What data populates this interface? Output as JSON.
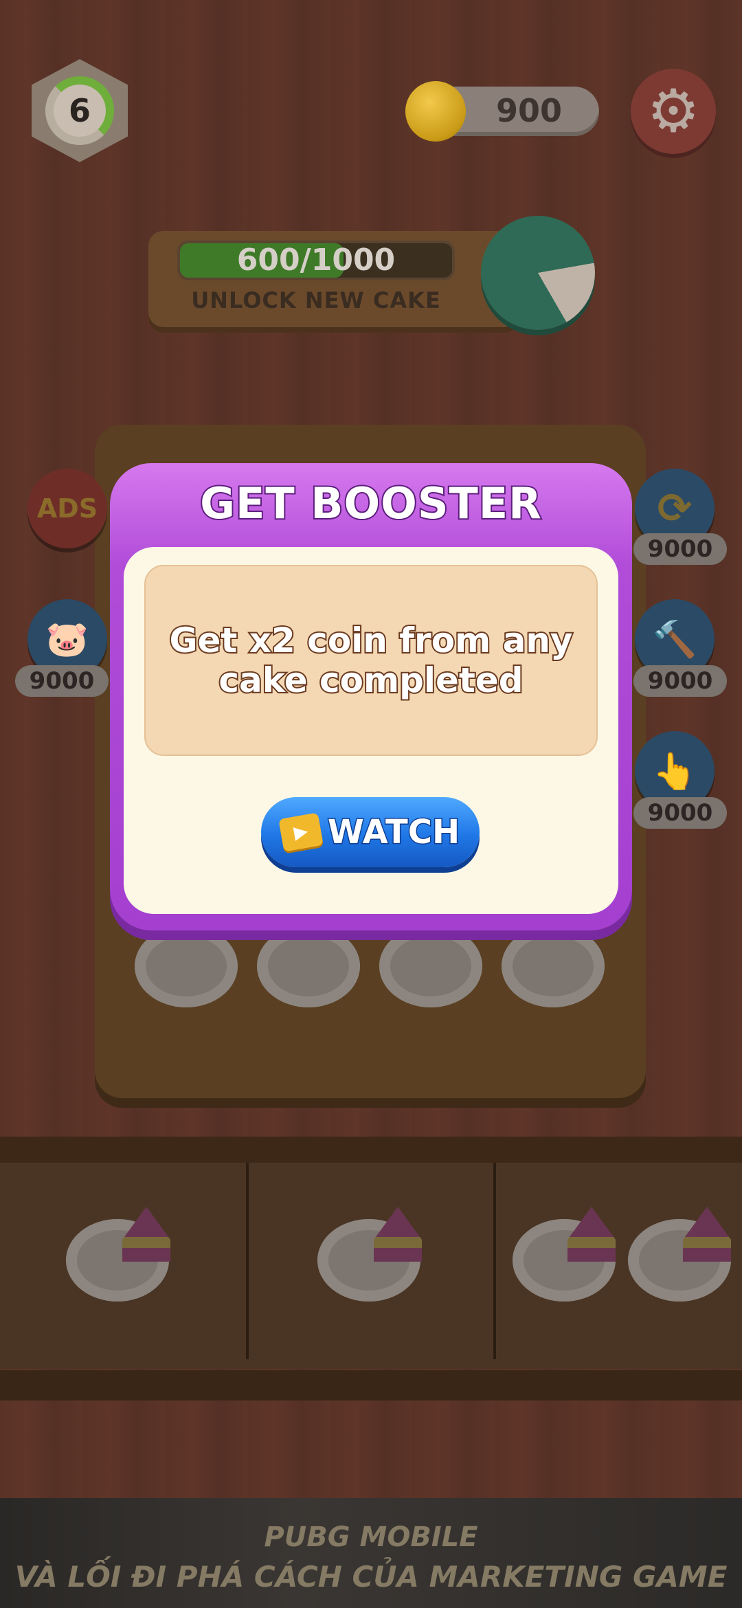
{
  "hud": {
    "level": "6",
    "level_progress": 0.6,
    "coins": "900",
    "settings_icon": "gear-icon"
  },
  "progress": {
    "text": "600/1000",
    "value": 600,
    "max": 1000,
    "label": "UNLOCK NEW CAKE"
  },
  "boosters": {
    "ads_label": "ADS",
    "left_price": "9000",
    "right_prices": [
      "9000",
      "9000",
      "9000"
    ]
  },
  "modal": {
    "title": "GET BOOSTER",
    "description": "Get x2 coin from any cake completed",
    "watch_label": "WATCH",
    "colors": {
      "header": "#b04cd8",
      "body": "#fdf8e6",
      "button": "#1f77e6"
    }
  },
  "ad_banner": {
    "line1": "PUBG MOBILE",
    "line2": "VÀ LỐI ĐI PHÁ CÁCH CỦA MARKETING GAME"
  }
}
